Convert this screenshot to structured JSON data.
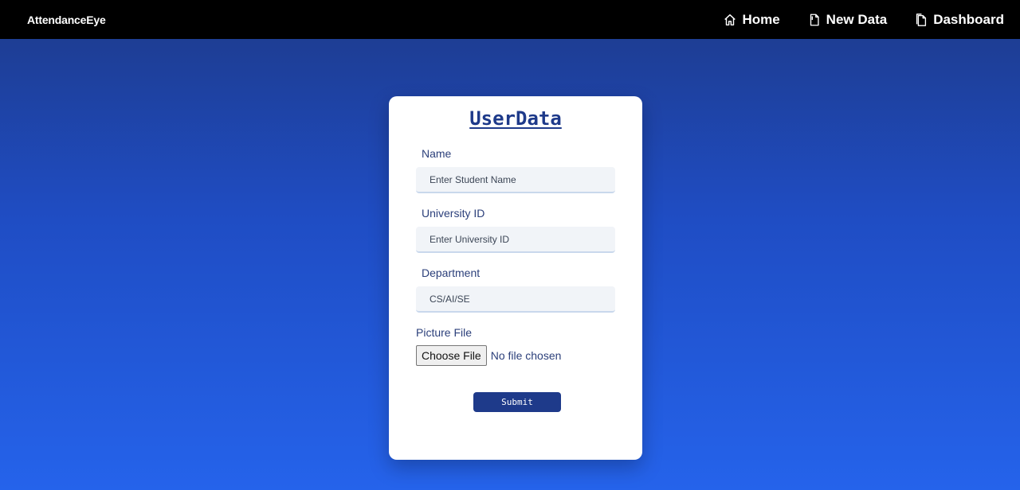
{
  "navbar": {
    "brand": "AttendanceEye",
    "links": [
      {
        "label": "Home",
        "icon": "home-icon"
      },
      {
        "label": "New Data",
        "icon": "document-icon"
      },
      {
        "label": "Dashboard",
        "icon": "documents-icon"
      }
    ]
  },
  "form": {
    "title": "UserData",
    "name": {
      "label": "Name",
      "placeholder": "Enter Student Name"
    },
    "university_id": {
      "label": "University ID",
      "placeholder": "Enter University ID"
    },
    "department": {
      "label": "Department",
      "placeholder": "CS/AI/SE"
    },
    "picture": {
      "label": "Picture File",
      "button": "Choose File",
      "status": "No file chosen"
    },
    "submit": "Submit"
  },
  "colors": {
    "navbar_bg": "#000000",
    "background_top": "#1e3a8a",
    "background_bottom": "#2563eb",
    "accent": "#1e3a8a"
  }
}
